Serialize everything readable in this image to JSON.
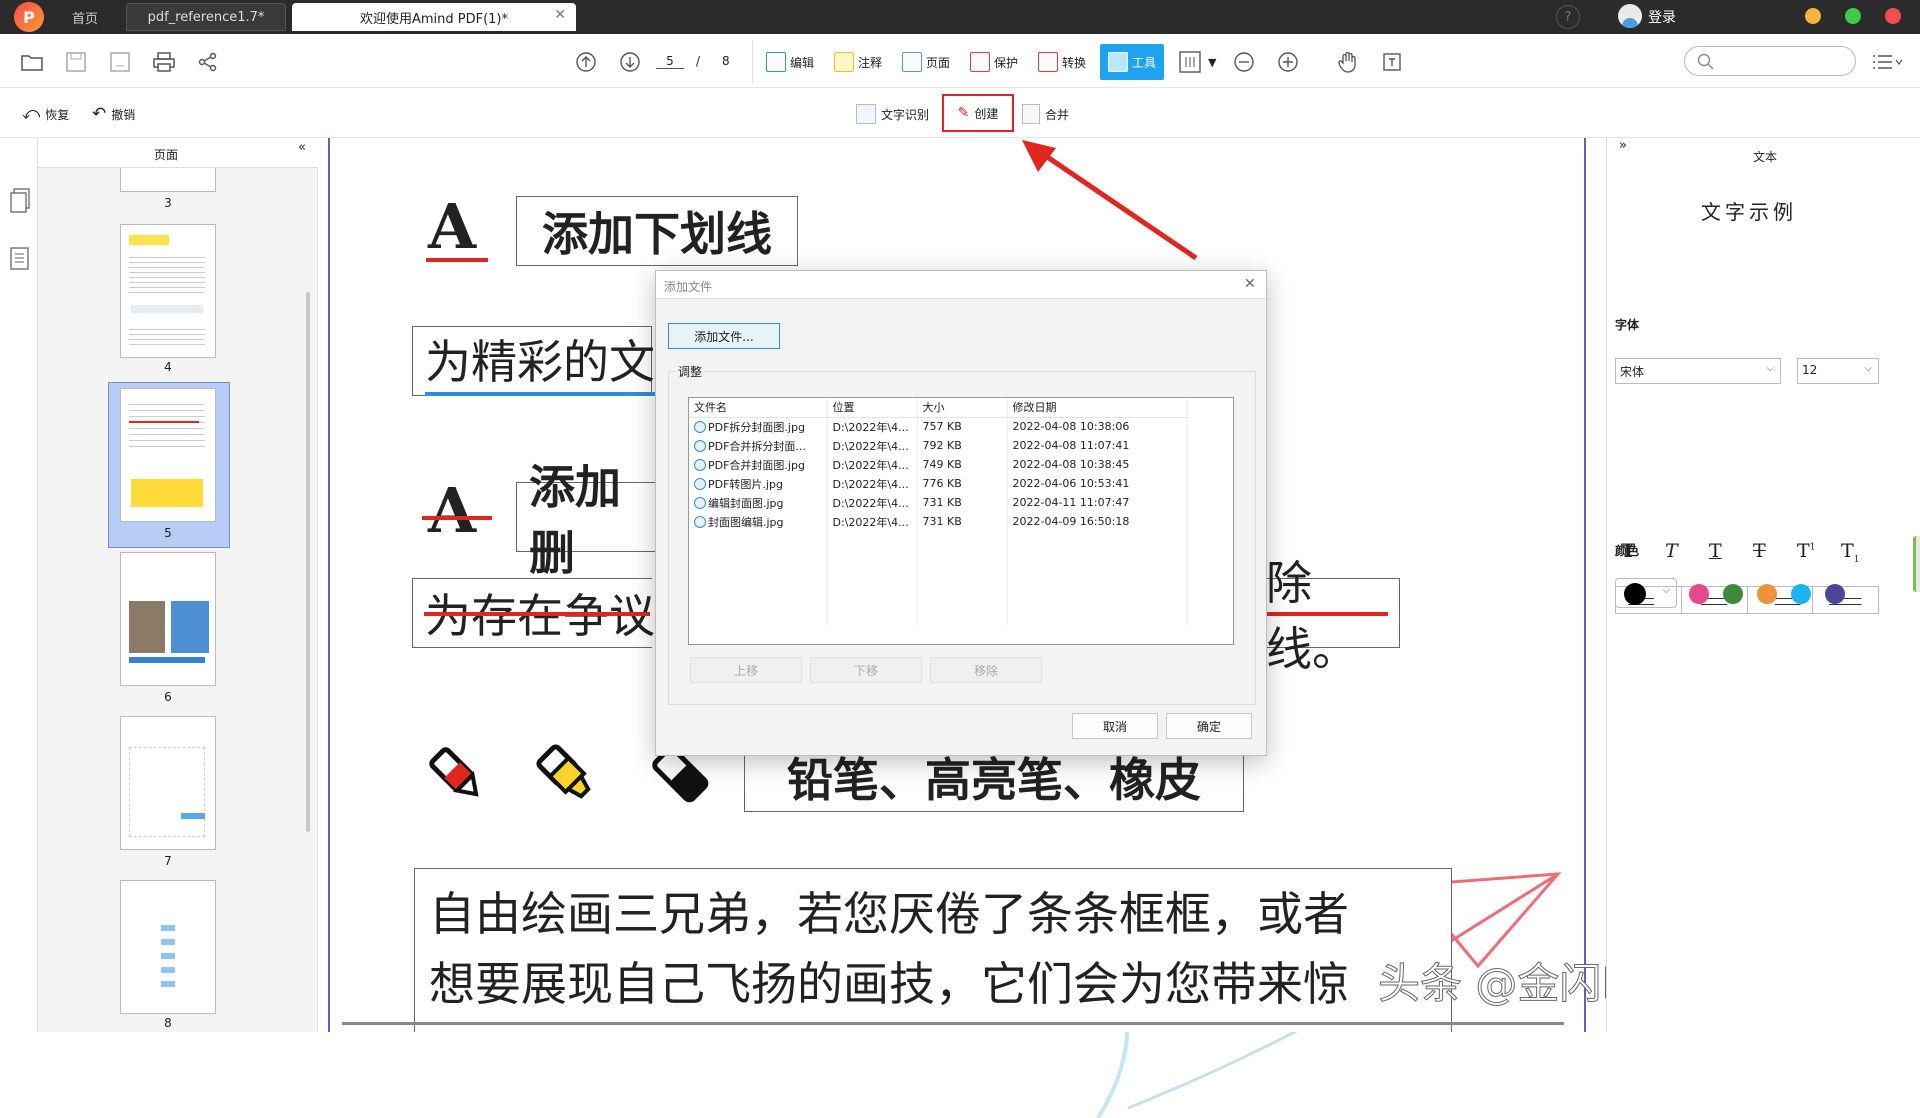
{
  "titlebar": {
    "home_tab": "首页",
    "tab1": "pdf_reference1.7*",
    "tab2": "欢迎使用Amind PDF(1)*",
    "login": "登录"
  },
  "toolbar": {
    "page_current": "5",
    "page_sep": "/",
    "page_total": "8",
    "ribbon": [
      {
        "label": "编辑"
      },
      {
        "label": "注释"
      },
      {
        "label": "页面"
      },
      {
        "label": "保护"
      },
      {
        "label": "转换"
      },
      {
        "label": "工具"
      }
    ]
  },
  "subbar": {
    "restore": "恢复",
    "undo": "撤销",
    "ocr": "文字识别",
    "create": "创建",
    "merge": "合并"
  },
  "thumbs": {
    "title": "页面",
    "pages": [
      "3",
      "4",
      "5",
      "6",
      "7",
      "8"
    ]
  },
  "doc": {
    "underline_title": "添加下划线",
    "underline_text": "为精彩的文",
    "strike_title": "添加删",
    "strike_text_left": "为存在争议",
    "strike_text_right": "除线。",
    "tools_title": "铅笔、高亮笔、橡皮",
    "para_line1": "自由绘画三兄弟，若您厌倦了条条框框，或者",
    "para_line2": "想要展现自己飞扬的画技，它们会为您带来惊",
    "watermark": "头条 @金闪PDF编辑器"
  },
  "rightpanel": {
    "title": "文本",
    "sample": "文字示例",
    "font_label": "字体",
    "font_value": "宋体",
    "size_value": "12",
    "color_label": "颜色",
    "colors": [
      "#000000",
      "#e8468d",
      "#3f8a3a",
      "#f0923a",
      "#1ab5ee",
      "#4d4597"
    ]
  },
  "dialog": {
    "title": "添加文件",
    "add_button": "添加文件...",
    "group_label": "调整",
    "columns": [
      "文件名",
      "位置",
      "大小",
      "修改日期"
    ],
    "rows": [
      {
        "name": "PDF拆分封面图.jpg",
        "loc": "D:\\2022年\\4...",
        "size": "757 KB",
        "date": "2022-04-08 10:38:06"
      },
      {
        "name": "PDF合并拆分封面...",
        "loc": "D:\\2022年\\4...",
        "size": "792 KB",
        "date": "2022-04-08 11:07:41"
      },
      {
        "name": "PDF合并封面图.jpg",
        "loc": "D:\\2022年\\4...",
        "size": "749 KB",
        "date": "2022-04-08 10:38:45"
      },
      {
        "name": "PDF转图片.jpg",
        "loc": "D:\\2022年\\4...",
        "size": "776 KB",
        "date": "2022-04-06 10:53:41"
      },
      {
        "name": "编辑封面图.jpg",
        "loc": "D:\\2022年\\4...",
        "size": "731 KB",
        "date": "2022-04-11 11:07:47"
      },
      {
        "name": "封面图编辑.jpg",
        "loc": "D:\\2022年\\4...",
        "size": "731 KB",
        "date": "2022-04-09 16:50:18"
      }
    ],
    "up": "上移",
    "down": "下移",
    "remove": "移除",
    "cancel": "取消",
    "ok": "确定"
  }
}
